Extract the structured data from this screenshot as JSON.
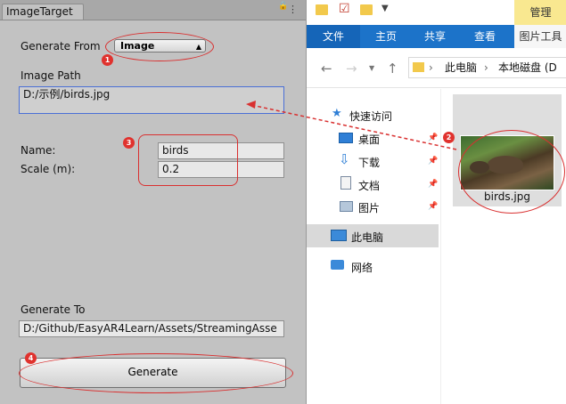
{
  "unity": {
    "tab_title": "ImageTarget",
    "generate_from_label": "Generate From",
    "generate_from_value": "Image",
    "image_path_label": "Image Path",
    "image_path_value": "D:/示例/birds.jpg",
    "name_label": "Name:",
    "name_value": "birds",
    "scale_label": "Scale (m):",
    "scale_value": "0.2",
    "generate_to_label": "Generate To",
    "generate_to_value": "D:/Github/EasyAR4Learn/Assets/StreamingAsse",
    "generate_button": "Generate",
    "badges": [
      "1",
      "3",
      "4"
    ]
  },
  "explorer": {
    "ribbon_tabs": [
      "文件",
      "主页",
      "共享",
      "查看"
    ],
    "manage_tab": "管理",
    "picture_tools_tab": "图片工具",
    "address_parts": [
      "此电脑",
      "本地磁盘 (D"
    ],
    "quick_access": "快速访问",
    "quick_items": [
      "桌面",
      "下载",
      "文档",
      "图片"
    ],
    "this_pc": "此电脑",
    "network": "网络",
    "file_name": "birds.jpg",
    "badge": "2"
  },
  "colors": {
    "ribbon": "#1c73c9",
    "annotation": "#d93030",
    "unity_bg": "#c2c2c2"
  }
}
